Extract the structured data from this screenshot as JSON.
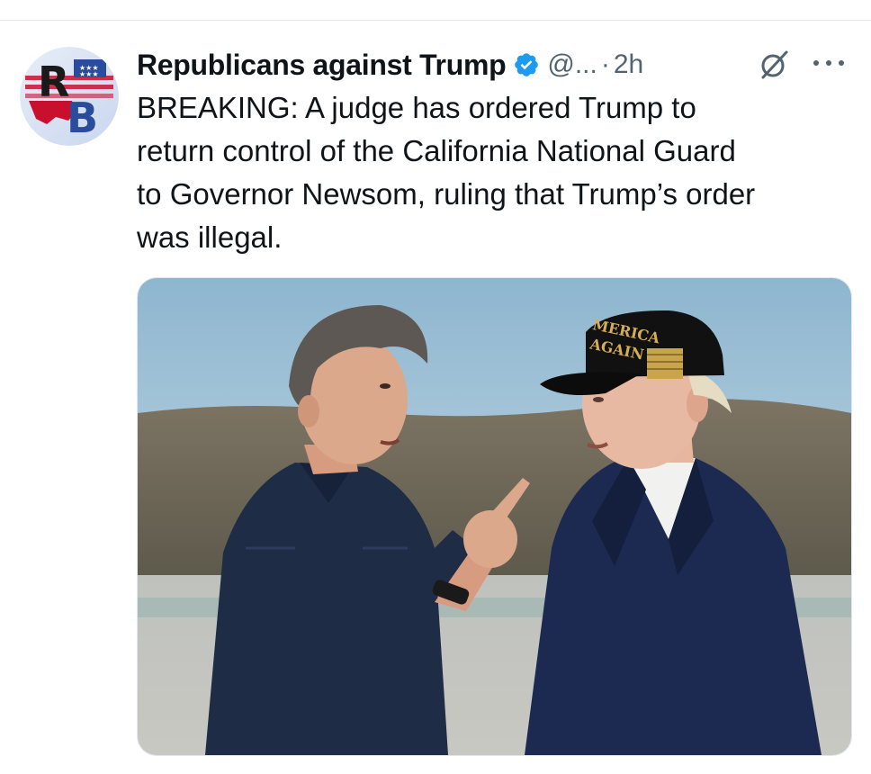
{
  "tweet": {
    "display_name": "Republicans against Trump",
    "handle": "@...",
    "separator": "·",
    "time": "2h",
    "text": "BREAKING: A judge has ordered Trump to\nreturn control of the California National Guard\nto Governor Newsom, ruling that Trump’s order\nwas illegal.",
    "avatar_letters": "RB",
    "hat_text_line1": "MERICA",
    "hat_text_line2": "AGAIN"
  },
  "colors": {
    "verified_blue": "#1d9bf0",
    "secondary_text": "#536471",
    "avatar_red": "#c8102e",
    "avatar_blue": "#2a4d9b"
  },
  "icons": {
    "verified": "verified-badge-icon",
    "grok": "grok-icon",
    "more": "more-options-icon"
  }
}
